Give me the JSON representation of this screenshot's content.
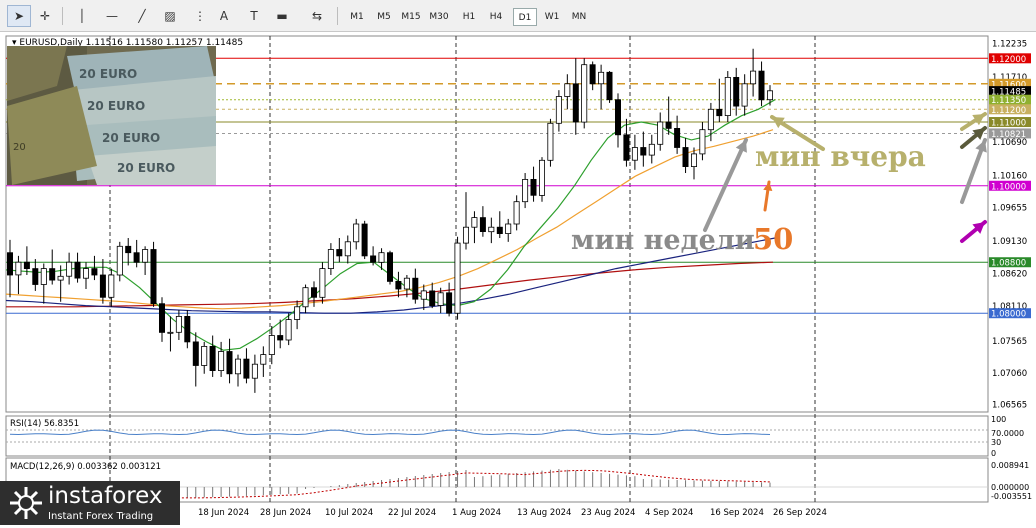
{
  "toolbar": {
    "tools": [
      {
        "name": "cursor-tool",
        "glyph": "➤"
      },
      {
        "name": "crosshair-tool",
        "glyph": "✛"
      },
      {
        "name": "vertical-line-tool",
        "glyph": "│"
      },
      {
        "name": "horizontal-line-tool",
        "glyph": "—"
      },
      {
        "name": "trendline-tool",
        "glyph": "╱"
      },
      {
        "name": "channel-tool",
        "glyph": "▨"
      },
      {
        "name": "fibonacci-tool",
        "glyph": "⋮"
      },
      {
        "name": "text-tool",
        "glyph": "A"
      },
      {
        "name": "label-tool",
        "glyph": "T"
      },
      {
        "name": "rectangle-tool",
        "glyph": "▬"
      },
      {
        "name": "arrow-tool",
        "glyph": "⇆"
      }
    ],
    "timeframes": [
      "M1",
      "M5",
      "M15",
      "M30",
      "H1",
      "H4",
      "D1",
      "W1",
      "MN"
    ],
    "active_timeframe": "D1"
  },
  "chart": {
    "symbol_label": "EURUSD,Daily",
    "ohlc": "1.11516 1.11580 1.11257 1.11485",
    "price_axis_labels": [
      "1.12235",
      "1.11710",
      "1.11180",
      "1.10690",
      "1.10160",
      "1.09655",
      "1.09130",
      "1.08620",
      "1.08110",
      "1.07565",
      "1.07060",
      "1.06565"
    ],
    "price_tags": [
      {
        "text": "1.12000",
        "bg": "#e00000",
        "y": 1.12
      },
      {
        "text": "1.11600",
        "bg": "#d39a2a",
        "y": 1.116
      },
      {
        "text": "1.11485",
        "bg": "#000000",
        "y": 1.11485
      },
      {
        "text": "1.11350",
        "bg": "#8fb030",
        "y": 1.1135
      },
      {
        "text": "1.11200",
        "bg": "#c8b060",
        "y": 1.112
      },
      {
        "text": "1.11000",
        "bg": "#8a8a2a",
        "y": 1.11
      },
      {
        "text": "1.10821",
        "bg": "#9a9a9a",
        "y": 1.10821
      },
      {
        "text": "1.10000",
        "bg": "#d000d0",
        "y": 1.1
      },
      {
        "text": "1.08800",
        "bg": "#2a8a2a",
        "y": 1.088
      },
      {
        "text": "1.08000",
        "bg": "#3a6ad0",
        "y": 1.08
      }
    ],
    "date_labels": [
      "18 Jun 2024",
      "28 Jun 2024",
      "10 Jul 2024",
      "22 Jul 2024",
      "1 Aug 2024",
      "13 Aug 2024",
      "23 Aug 2024",
      "4 Sep 2024",
      "16 Sep 2024",
      "26 Sep 2024"
    ],
    "annotations": {
      "min_yesterday": "мин вчера",
      "min_week": "мин недели",
      "ma_50": "50"
    },
    "colors": {
      "ma_fast": "#2ea02e",
      "ma_50": "#f0a030",
      "ma_blue": "#1a237e",
      "ma_red": "#b01010",
      "rsi": "#4a80c8",
      "macd_signal": "#c00000"
    }
  },
  "rsi": {
    "label": "RSI(14) 56.8351",
    "axis_labels": [
      "100",
      "70.0000",
      "30",
      "0"
    ]
  },
  "macd": {
    "label": "MACD(12,26,9) 0.003362 0.003121",
    "axis_labels": [
      "0.008941",
      "0.000000",
      "-0.003551"
    ]
  },
  "logo": {
    "brand": "instaforex",
    "tagline": "Instant Forex Trading"
  },
  "chart_data": {
    "type": "candlestick",
    "title": "EURUSD,Daily",
    "ylim": [
      1.0645,
      1.1235
    ],
    "candles": [
      [
        1.0895,
        1.0915,
        1.0825,
        1.086
      ],
      [
        1.086,
        1.089,
        1.083,
        1.088
      ],
      [
        1.088,
        1.0905,
        1.086,
        1.087
      ],
      [
        1.087,
        1.0885,
        1.0835,
        1.0845
      ],
      [
        1.0845,
        1.0878,
        1.0815,
        1.087
      ],
      [
        1.087,
        1.09,
        1.0845,
        1.0852
      ],
      [
        1.0852,
        1.0875,
        1.0818,
        1.0858
      ],
      [
        1.0858,
        1.0895,
        1.0845,
        1.088
      ],
      [
        1.088,
        1.0895,
        1.0848,
        1.0855
      ],
      [
        1.0855,
        1.088,
        1.0838,
        1.087
      ],
      [
        1.087,
        1.089,
        1.0852,
        1.086
      ],
      [
        1.086,
        1.0885,
        1.0815,
        1.0825
      ],
      [
        1.0825,
        1.087,
        1.081,
        1.086
      ],
      [
        1.086,
        1.0912,
        1.085,
        1.0905
      ],
      [
        1.0905,
        1.0918,
        1.0875,
        1.0895
      ],
      [
        1.0895,
        1.0915,
        1.0872,
        1.088
      ],
      [
        1.088,
        1.0905,
        1.086,
        1.09
      ],
      [
        1.09,
        1.0912,
        1.081,
        1.0815
      ],
      [
        1.0815,
        1.0825,
        1.0755,
        1.077
      ],
      [
        1.077,
        1.0795,
        1.074,
        1.077
      ],
      [
        1.077,
        1.0805,
        1.0758,
        1.0795
      ],
      [
        1.0795,
        1.0805,
        1.0745,
        1.0755
      ],
      [
        1.0755,
        1.077,
        1.0685,
        1.0718
      ],
      [
        1.0718,
        1.0755,
        1.0705,
        1.0748
      ],
      [
        1.0748,
        1.0765,
        1.07,
        1.071
      ],
      [
        1.071,
        1.0755,
        1.07,
        1.074
      ],
      [
        1.074,
        1.076,
        1.069,
        1.0705
      ],
      [
        1.0705,
        1.0735,
        1.0685,
        1.0728
      ],
      [
        1.0728,
        1.0745,
        1.069,
        1.0698
      ],
      [
        1.0698,
        1.0735,
        1.0675,
        1.072
      ],
      [
        1.072,
        1.0748,
        1.07,
        1.0735
      ],
      [
        1.0735,
        1.078,
        1.072,
        1.0765
      ],
      [
        1.0765,
        1.079,
        1.0745,
        1.0758
      ],
      [
        1.0758,
        1.08,
        1.075,
        1.079
      ],
      [
        1.079,
        1.082,
        1.0775,
        1.081
      ],
      [
        1.081,
        1.0845,
        1.08,
        1.084
      ],
      [
        1.084,
        1.085,
        1.081,
        1.0825
      ],
      [
        1.0825,
        1.088,
        1.0815,
        1.087
      ],
      [
        1.087,
        1.091,
        1.086,
        1.09
      ],
      [
        1.09,
        1.0918,
        1.088,
        1.089
      ],
      [
        1.089,
        1.0922,
        1.0878,
        1.0912
      ],
      [
        1.0912,
        1.0948,
        1.09,
        1.094
      ],
      [
        1.094,
        1.0945,
        1.0885,
        1.089
      ],
      [
        1.089,
        1.0905,
        1.0875,
        1.088
      ],
      [
        1.088,
        1.0902,
        1.0868,
        1.0895
      ],
      [
        1.0895,
        1.0898,
        1.0845,
        1.085
      ],
      [
        1.085,
        1.0865,
        1.0825,
        1.0838
      ],
      [
        1.0838,
        1.086,
        1.0825,
        1.0855
      ],
      [
        1.0855,
        1.087,
        1.0815,
        1.0822
      ],
      [
        1.0822,
        1.0845,
        1.0805,
        1.0835
      ],
      [
        1.0835,
        1.0848,
        1.0808,
        1.0812
      ],
      [
        1.0812,
        1.084,
        1.08,
        1.0832
      ],
      [
        1.0832,
        1.0848,
        1.0795,
        1.08
      ],
      [
        1.08,
        1.092,
        1.079,
        1.091
      ],
      [
        1.091,
        1.099,
        1.09,
        1.0935
      ],
      [
        1.0935,
        1.096,
        1.091,
        1.095
      ],
      [
        1.095,
        1.0968,
        1.092,
        1.0928
      ],
      [
        1.0928,
        1.095,
        1.091,
        1.0935
      ],
      [
        1.0935,
        1.096,
        1.0918,
        1.0925
      ],
      [
        1.0925,
        1.0948,
        1.0912,
        1.094
      ],
      [
        1.094,
        1.0985,
        1.093,
        1.0975
      ],
      [
        1.0975,
        1.102,
        1.0965,
        1.101
      ],
      [
        1.101,
        1.103,
        1.0975,
        1.0985
      ],
      [
        1.0985,
        1.1045,
        1.0975,
        1.104
      ],
      [
        1.104,
        1.1105,
        1.103,
        1.1098
      ],
      [
        1.1098,
        1.115,
        1.1085,
        1.114
      ],
      [
        1.114,
        1.1175,
        1.112,
        1.116
      ],
      [
        1.116,
        1.12,
        1.108,
        1.11
      ],
      [
        1.11,
        1.12,
        1.109,
        1.119
      ],
      [
        1.119,
        1.1195,
        1.115,
        1.116
      ],
      [
        1.116,
        1.119,
        1.112,
        1.1178
      ],
      [
        1.1178,
        1.118,
        1.113,
        1.1135
      ],
      [
        1.1135,
        1.1145,
        1.106,
        1.108
      ],
      [
        1.108,
        1.1105,
        1.103,
        1.104
      ],
      [
        1.104,
        1.108,
        1.1025,
        1.106
      ],
      [
        1.106,
        1.1085,
        1.103,
        1.1048
      ],
      [
        1.1048,
        1.108,
        1.1035,
        1.1065
      ],
      [
        1.1065,
        1.1115,
        1.1055,
        1.11
      ],
      [
        1.11,
        1.114,
        1.108,
        1.109
      ],
      [
        1.109,
        1.111,
        1.105,
        1.106
      ],
      [
        1.106,
        1.1075,
        1.102,
        1.103
      ],
      [
        1.103,
        1.106,
        1.101,
        1.105
      ],
      [
        1.105,
        1.11,
        1.104,
        1.1088
      ],
      [
        1.1088,
        1.113,
        1.107,
        1.112
      ],
      [
        1.112,
        1.1168,
        1.11,
        1.111
      ],
      [
        1.111,
        1.118,
        1.11,
        1.117
      ],
      [
        1.117,
        1.1185,
        1.111,
        1.1125
      ],
      [
        1.1125,
        1.1175,
        1.111,
        1.116
      ],
      [
        1.116,
        1.1215,
        1.114,
        1.118
      ],
      [
        1.118,
        1.1195,
        1.1125,
        1.1135
      ],
      [
        1.1135,
        1.1158,
        1.1126,
        1.1149
      ]
    ],
    "ma_fast": [
      1.0868,
      1.0866,
      1.0864,
      1.0866,
      1.087,
      1.0872,
      1.0872,
      1.086,
      1.084,
      1.0815,
      1.079,
      1.077,
      1.0755,
      1.0742,
      1.0745,
      1.076,
      1.0778,
      1.0798,
      1.082,
      1.084,
      1.0862,
      1.0878,
      1.088,
      1.086,
      1.084,
      1.0823,
      1.0815,
      1.0812,
      1.0818,
      1.0838,
      1.0868,
      1.0905,
      1.0935,
      1.0965,
      1.1,
      1.104,
      1.1075,
      1.1095,
      1.11,
      1.1095,
      1.108,
      1.1072,
      1.1078,
      1.1095,
      1.111,
      1.112,
      1.1135
    ],
    "ma_50": [
      1.083,
      1.0828,
      1.0826,
      1.0824,
      1.0822,
      1.082,
      1.0818,
      1.0815,
      1.0812,
      1.081,
      1.0808,
      1.0807,
      1.0808,
      1.081,
      1.0812,
      1.0815,
      1.0818,
      1.0822,
      1.0826,
      1.083,
      1.0834,
      1.084,
      1.0848,
      1.0858,
      1.087,
      1.0885,
      1.09,
      1.0918,
      1.0935,
      1.0955,
      1.0975,
      1.0995,
      1.1015,
      1.103,
      1.1045,
      1.1055,
      1.1062,
      1.107,
      1.1078,
      1.1088
    ],
    "ma_blue": [
      1.082,
      1.0818,
      1.0815,
      1.0812,
      1.081,
      1.0808,
      1.0806,
      1.0804,
      1.0803,
      1.0802,
      1.0802,
      1.0801,
      1.08,
      1.08,
      1.0802,
      1.0805,
      1.081,
      1.0815,
      1.0822,
      1.083,
      1.084,
      1.085,
      1.086,
      1.087,
      1.0878,
      1.0886,
      1.0894,
      1.0902,
      1.091,
      1.0918
    ],
    "ma_red": [
      1.081,
      1.081,
      1.081,
      1.0811,
      1.0812,
      1.0813,
      1.0814,
      1.0815,
      1.0817,
      1.082,
      1.0823,
      1.0827,
      1.0832,
      1.0838,
      1.0845,
      1.0852,
      1.0858,
      1.0863,
      1.0868,
      1.0872,
      1.0875,
      1.0878,
      1.088
    ]
  }
}
